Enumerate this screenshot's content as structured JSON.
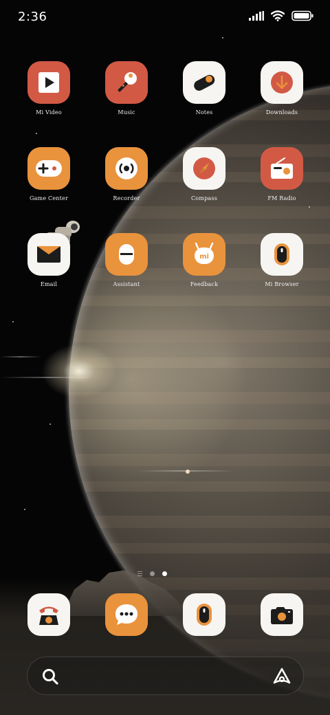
{
  "status_bar": {
    "time": "2:36",
    "signal_icon": "signal-icon",
    "wifi_icon": "wifi-icon",
    "battery_icon": "battery-icon",
    "battery_level": 1.0
  },
  "colors": {
    "red": "#d25a45",
    "orange": "#e9933d",
    "white": "#f7f5f2",
    "ink": "#1c1c1c"
  },
  "apps": [
    {
      "label": "Mi Video",
      "icon": "play-icon"
    },
    {
      "label": "Music",
      "icon": "microphone-icon"
    },
    {
      "label": "Notes",
      "icon": "notes-toggle-icon"
    },
    {
      "label": "Downloads",
      "icon": "download-arrow-icon"
    },
    {
      "label": "Game Center",
      "icon": "gamepad-icon"
    },
    {
      "label": "Recorder",
      "icon": "record-icon"
    },
    {
      "label": "Compass",
      "icon": "compass-needle-icon"
    },
    {
      "label": "FM Radio",
      "icon": "radio-icon"
    },
    {
      "label": "Email",
      "icon": "envelope-icon"
    },
    {
      "label": "Assistant",
      "icon": "assistant-capsule-icon"
    },
    {
      "label": "Feedback",
      "icon": "mi-bunny-icon"
    },
    {
      "label": "Mi Browser",
      "icon": "browser-capsule-icon"
    }
  ],
  "dock": [
    {
      "icon": "phone-icon"
    },
    {
      "icon": "message-icon"
    },
    {
      "icon": "browser-capsule-icon"
    },
    {
      "icon": "camera-icon"
    }
  ],
  "pager": {
    "pages": 2,
    "current": 2
  },
  "search_bar": {
    "left_icon": "search-icon",
    "right_icon": "assistant-a-icon"
  }
}
